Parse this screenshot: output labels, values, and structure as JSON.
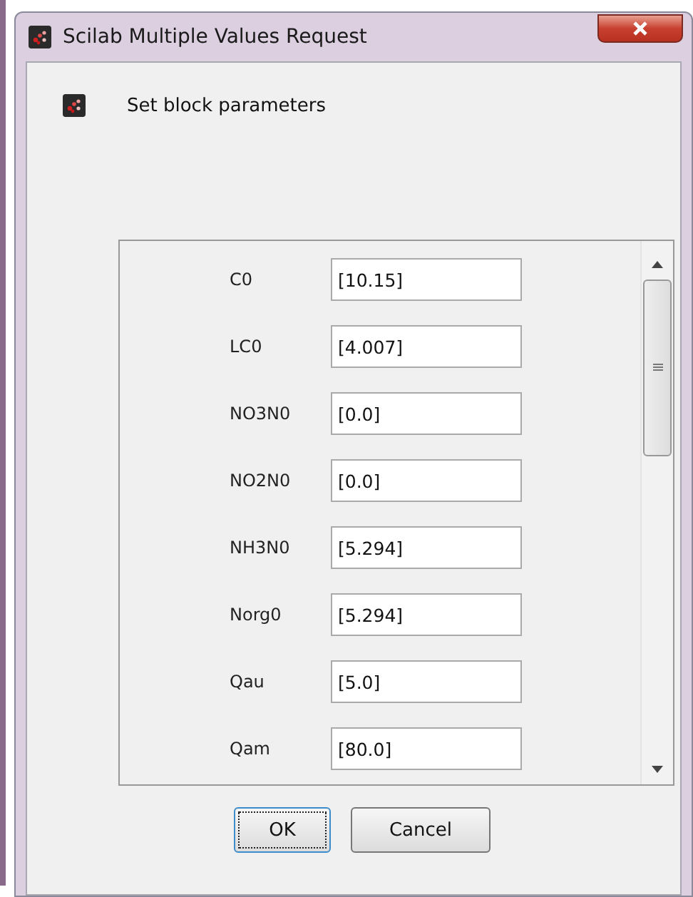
{
  "window": {
    "title": "Scilab Multiple Values Request"
  },
  "header": {
    "text": "Set block parameters"
  },
  "fields": [
    {
      "label": "C0",
      "value": "[10.15]"
    },
    {
      "label": "LC0",
      "value": "[4.007]"
    },
    {
      "label": "NO3N0",
      "value": "[0.0]"
    },
    {
      "label": "NO2N0",
      "value": "[0.0]"
    },
    {
      "label": "NH3N0",
      "value": "[5.294]"
    },
    {
      "label": "Norg0",
      "value": "[5.294]"
    },
    {
      "label": "Qau",
      "value": "[5.0]"
    },
    {
      "label": "Qam",
      "value": "[80.0]"
    }
  ],
  "buttons": [
    {
      "label": "OK",
      "focused": true
    },
    {
      "label": "Cancel",
      "focused": false
    }
  ]
}
